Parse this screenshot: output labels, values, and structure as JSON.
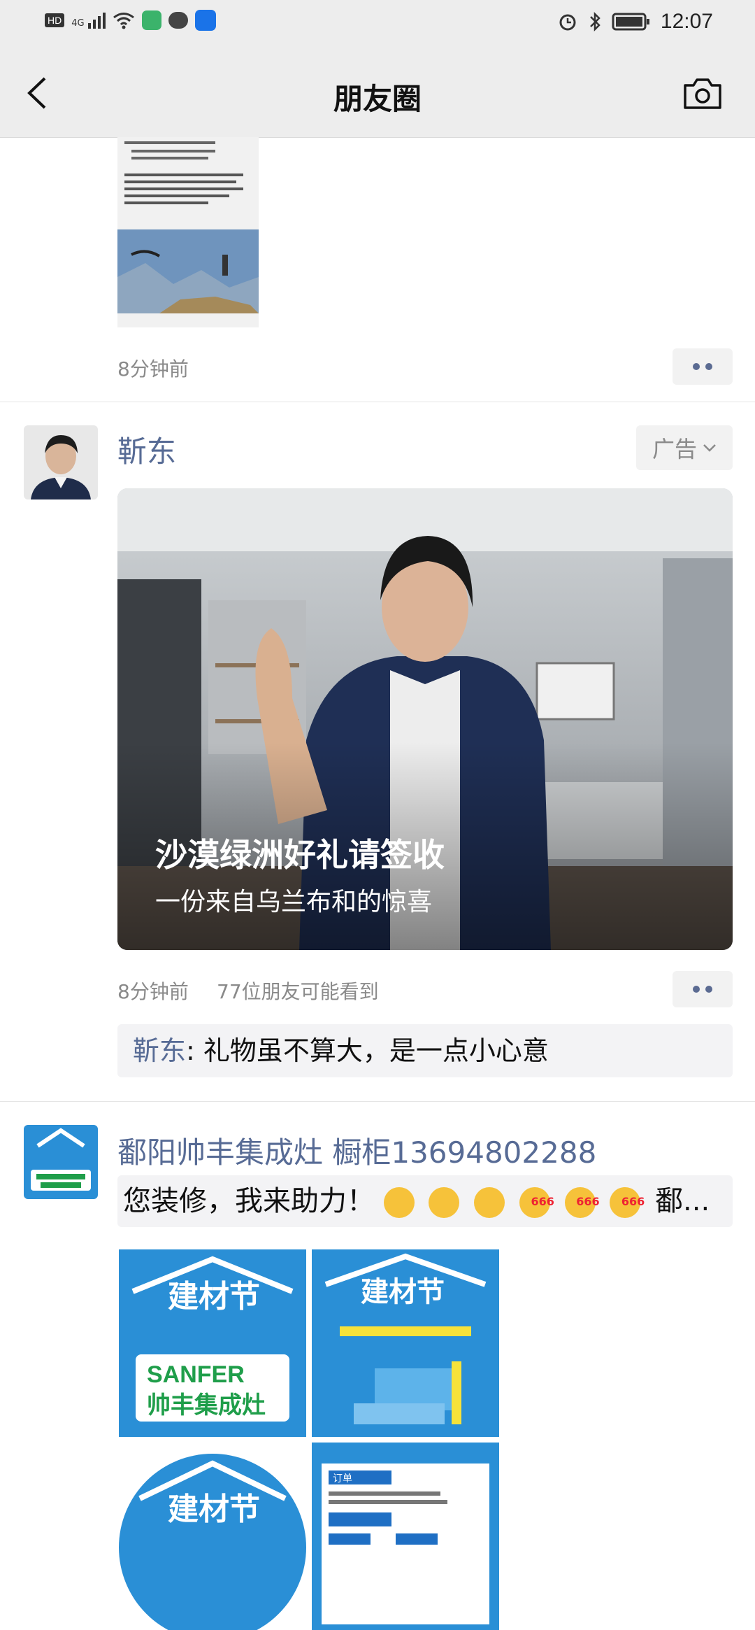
{
  "status_bar": {
    "left_icons": [
      "hd-icon",
      "signal-4g-icon",
      "wifi-icon",
      "app-notification-icon",
      "chat-bubble-icon",
      "bulb-app-icon"
    ],
    "network_label": "4G",
    "hd_label": "HD",
    "right_icons": [
      "alarm-icon",
      "bluetooth-icon",
      "battery-icon"
    ],
    "time": "12:07"
  },
  "nav": {
    "title": "朋友圈",
    "back_icon": "chevron-left-icon",
    "camera_icon": "camera-icon"
  },
  "posts": [
    {
      "time": "8分钟前",
      "more_icon": "more-dots-icon"
    },
    {
      "author": "靳东",
      "ad_label": "广告",
      "ad_chevron_icon": "chevron-down-icon",
      "image_headline": "沙漠绿洲好礼请签收",
      "image_subtitle": "一份来自乌兰布和的惊喜",
      "time": "8分钟前",
      "reach": "77位朋友可能看到",
      "more_icon": "more-dots-icon",
      "comment": {
        "name": "靳东",
        "text": ": 礼物虽不算大，是一点小心意"
      }
    },
    {
      "author": "鄱阳帅丰集成灶 橱柜13694802288",
      "text_start": "您装修，我来助力！",
      "text_end": "鄱...",
      "grid_titles": [
        "建材节",
        "建材节",
        "建材节",
        "订单"
      ],
      "brand_en": "SANFER",
      "brand_cn": "帅丰集成灶"
    }
  ],
  "colors": {
    "link": "#576b95",
    "nav_bg": "#ededed",
    "muted": "#8a8a8a",
    "box_bg": "#f3f3f5",
    "poster_blue": "#2a8fd6"
  }
}
